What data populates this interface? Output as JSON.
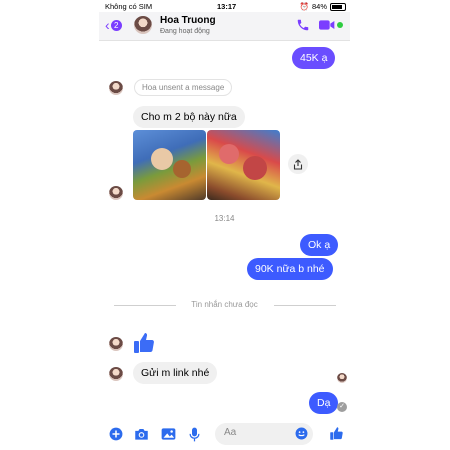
{
  "status_bar": {
    "carrier": "Không có SIM",
    "time": "13:17",
    "battery": "84%"
  },
  "header": {
    "unread_count": "2",
    "name": "Hoa Truong",
    "status": "Đang hoạt động"
  },
  "messages": {
    "m1": "45K ạ",
    "unsent": "Hoa unsent a message",
    "m2": "Cho m 2 bộ này nữa",
    "time1": "13:14",
    "m3": "Ok ạ",
    "m4": "90K nữa b nhé",
    "unread_divider": "Tin nhắn chưa đọc",
    "m5": "Gửi m link nhé",
    "m6": "Dạ"
  },
  "composer": {
    "placeholder": "Aa"
  },
  "colors": {
    "accent": "#7b3dff",
    "outgoing_purple": "#6a4dff",
    "outgoing_blue": "#3d5bff",
    "like_blue": "#3b6cf6"
  }
}
